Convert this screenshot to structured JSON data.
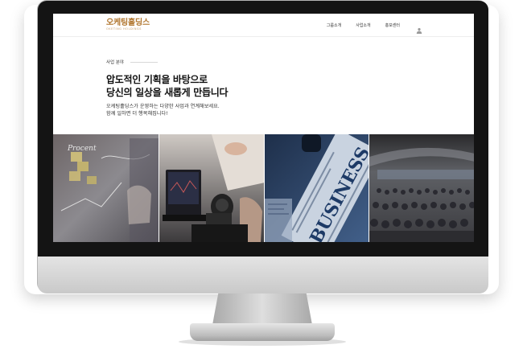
{
  "site": {
    "logo_text": "오케팅홀딩스",
    "logo_sub": "OKETING HOLDINGS"
  },
  "nav": {
    "items": [
      "그룹소개",
      "사업소개",
      "홍보센터"
    ],
    "user_icon": "user-icon"
  },
  "content": {
    "section_label": "사업 분야",
    "headline_line1": "압도적인 기획을 바탕으로",
    "headline_line2": "당신의 일상을 새롭게 만듭니다",
    "desc_line1": "오케팅홀딩스가 운영하는 다양한 사업과 연계해보세요.",
    "desc_line2": "함께 일하면 더 행복해집니다!"
  },
  "photos": [
    {
      "label": "Procent",
      "subject": "planning-whiteboard"
    },
    {
      "label": "",
      "subject": "video-editing-camera"
    },
    {
      "label": "BUSINESS",
      "subject": "newspaper"
    },
    {
      "label": "",
      "subject": "conference-audience"
    }
  ],
  "colors": {
    "brand": "#b0752d",
    "text_dark": "#111111",
    "monitor_bezel": "#141414",
    "monitor_silver": "#d0d0d0"
  }
}
